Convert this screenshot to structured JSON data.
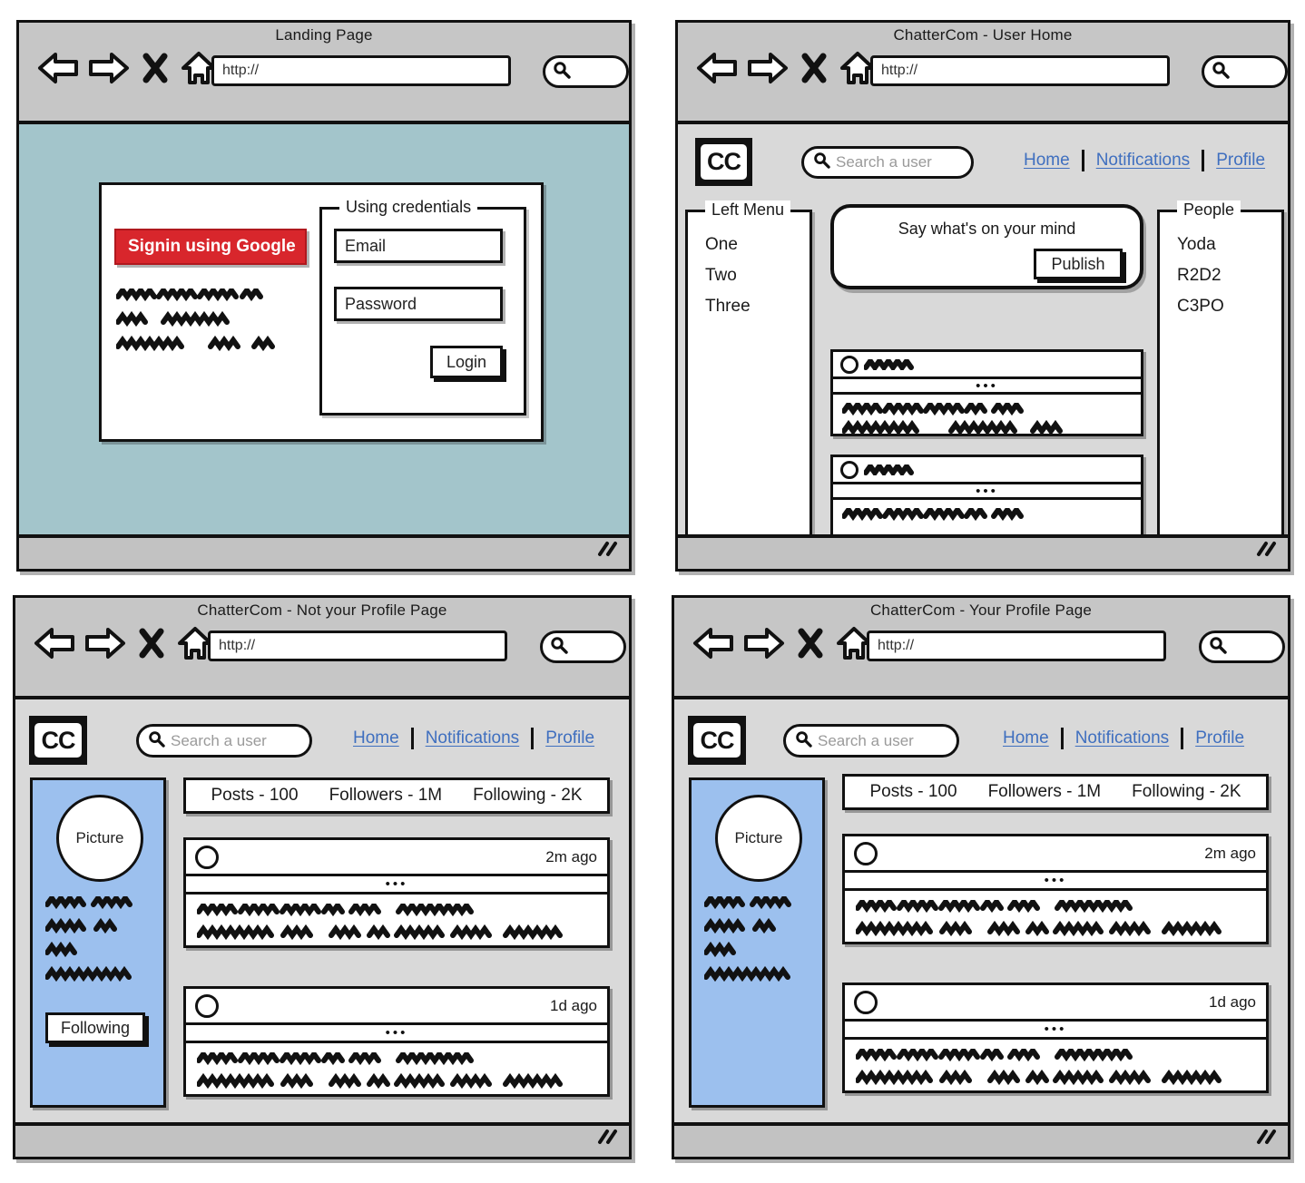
{
  "meta": {
    "kind": "wireframe-mockup",
    "panel_count": 4,
    "accent_red": "#d8262c",
    "accent_link": "#3f6fbf",
    "teal_bg": "#a3c5cb",
    "profile_side_bg": "#9cc0ee",
    "chrome_bg": "#c6c6c6"
  },
  "common": {
    "url_value": "http://",
    "brand_logo": "CC",
    "search_placeholder": "Search a user",
    "nav": [
      {
        "label": "Home"
      },
      {
        "label": "Notifications"
      },
      {
        "label": "Profile"
      }
    ],
    "icons": {
      "back": "back-arrow-icon",
      "forward": "forward-arrow-icon",
      "stop": "close-x-icon",
      "home": "home-icon",
      "search": "search-icon",
      "grip": "resize-grip-icon"
    }
  },
  "panel1": {
    "title": "Landing Page",
    "google_button": "Signin using Google",
    "credentials_caption": "Using credentials",
    "email_label": "Email",
    "password_label": "Password",
    "login_button": "Login",
    "blurb_lines": 3
  },
  "panel2": {
    "title": "ChatterCom - User Home",
    "left_menu": {
      "caption": "Left Menu",
      "items": [
        "One",
        "Two",
        "Three"
      ]
    },
    "compose": {
      "placeholder": "Say what's on your mind",
      "publish_button": "Publish"
    },
    "people": {
      "caption": "People",
      "items": [
        "Yoda",
        "R2D2",
        "C3PO"
      ]
    },
    "posts": [
      {
        "time": "",
        "body_lines": 2
      },
      {
        "time": "",
        "body_lines": 2
      }
    ]
  },
  "panel3": {
    "title": "ChatterCom - Not your Profile Page",
    "profile": {
      "picture_label": "Picture",
      "bio_lines": 4,
      "follow_button": "Following"
    },
    "stats": [
      {
        "label": "Posts - 100"
      },
      {
        "label": "Followers - 1M"
      },
      {
        "label": "Following - 2K"
      }
    ],
    "posts": [
      {
        "time": "2m ago",
        "body_lines": 2
      },
      {
        "time": "1d ago",
        "body_lines": 2
      }
    ]
  },
  "panel4": {
    "title": "ChatterCom - Your Profile Page",
    "profile": {
      "picture_label": "Picture",
      "bio_lines": 4
    },
    "stats": [
      {
        "label": "Posts - 100"
      },
      {
        "label": "Followers - 1M"
      },
      {
        "label": "Following - 2K"
      }
    ],
    "posts": [
      {
        "time": "2m ago",
        "body_lines": 2
      },
      {
        "time": "1d ago",
        "body_lines": 2
      }
    ]
  }
}
